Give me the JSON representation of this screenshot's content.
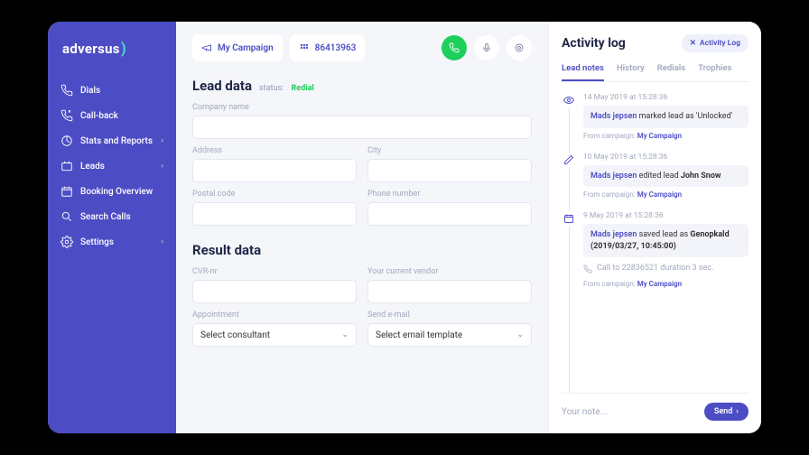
{
  "brand": "adversus",
  "sidebar": {
    "items": [
      {
        "label": "Dials",
        "icon": "phone"
      },
      {
        "label": "Call-back",
        "icon": "callback"
      },
      {
        "label": "Stats and Reports",
        "icon": "stats",
        "expandable": true
      },
      {
        "label": "Leads",
        "icon": "leads",
        "expandable": true
      },
      {
        "label": "Booking Overview",
        "icon": "calendar"
      },
      {
        "label": "Search Calls",
        "icon": "search"
      },
      {
        "label": "Settings",
        "icon": "gear",
        "expandable": true
      }
    ]
  },
  "topbar": {
    "campaign": "My Campaign",
    "dialpad": "86413963"
  },
  "lead": {
    "title": "Lead data",
    "status_label": "status:",
    "status_value": "Redial",
    "fields": {
      "company": "Company name",
      "address": "Address",
      "city": "City",
      "postal": "Postal code",
      "phone": "Phone number"
    }
  },
  "result": {
    "title": "Result data",
    "fields": {
      "cvr": "CVR-nr",
      "vendor": "Your current vendor",
      "appointment": "Appointment",
      "appointment_ph": "Select consultant",
      "email": "Send e-mail",
      "email_ph": "Select email template"
    }
  },
  "activity": {
    "title": "Activity log",
    "button": "Activity Log",
    "tabs": [
      "Lead notes",
      "History",
      "Redials",
      "Trophies"
    ],
    "entries": [
      {
        "icon": "eye",
        "ts": "14 May 2019 at 15:28:36",
        "user": "Mads jepsen",
        "text": " marked lead as 'Unlocked'",
        "meta_label": "From campaign: ",
        "meta_val": "My Campaign"
      },
      {
        "icon": "edit",
        "ts": "10 May 2019 at 15:28:36",
        "user": "Mads jepsen",
        "text": " edited lead ",
        "suffix": "John Snow",
        "meta_label": "From campaign: ",
        "meta_val": "My Campaign"
      },
      {
        "icon": "calendar",
        "ts": "9 May 2019 at 15:28:36",
        "user": "Mads jepsen",
        "text": " saved lead as ",
        "suffix": "Genopkald (2019/03/27, 10:45:00)",
        "sub": "Call to 22836521 duration 3 sec.",
        "meta_label": "From campaign: ",
        "meta_val": "My Campaign"
      }
    ],
    "note_placeholder": "Your note...",
    "send": "Send"
  }
}
